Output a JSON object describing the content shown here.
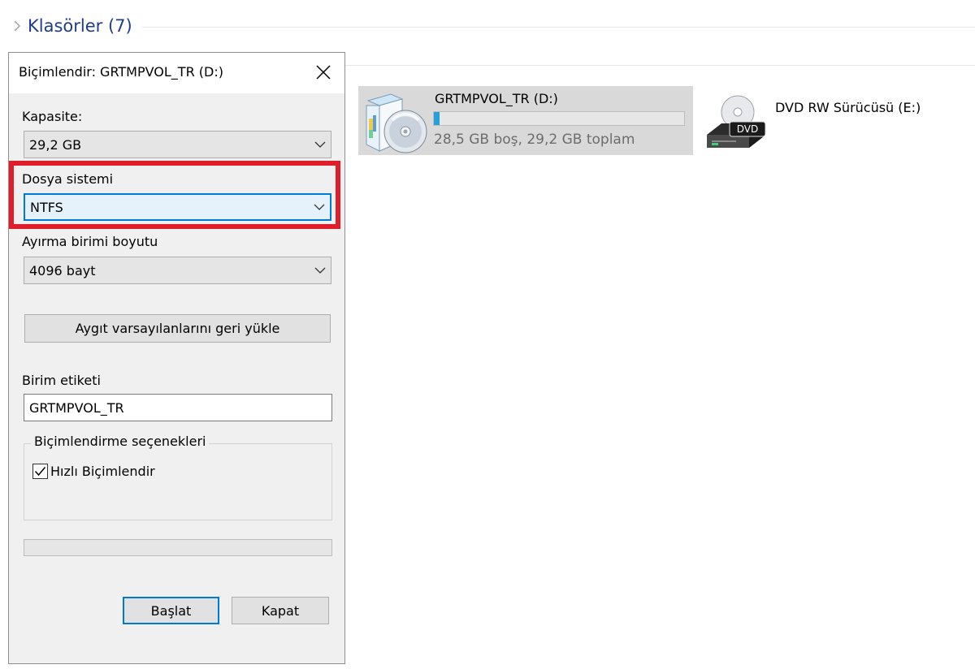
{
  "explorer": {
    "section_title": "Klasörler (7)",
    "drives": [
      {
        "name": "GRTMPVOL_TR (D:)",
        "space": "28,5 GB boş, 29,2 GB toplam",
        "used_fraction": 0.024,
        "bar_color": "#26a0da"
      },
      {
        "name": "DVD RW Sürücüsü (E:)",
        "icon_label": "DVD"
      }
    ]
  },
  "dialog": {
    "title": "Biçimlendir: GRTMPVOL_TR (D:)",
    "capacity_label": "Kapasite:",
    "capacity_value": "29,2 GB",
    "filesystem_label": "Dosya sistemi",
    "filesystem_value": "NTFS",
    "allocation_label": "Ayırma birimi boyutu",
    "allocation_value": "4096 bayt",
    "restore_button": "Aygıt varsayılanlarını geri yükle",
    "volume_label_label": "Birim etiketi",
    "volume_label_value": "GRTMPVOL_TR",
    "options_legend": "Biçimlendirme seçenekleri",
    "quick_format_label": "Hızlı Biçimlendir",
    "quick_format_checked": true,
    "progress_value": 0,
    "start_button": "Başlat",
    "close_button": "Kapat"
  },
  "colors": {
    "accent": "#0078d7",
    "highlight": "#e01e2b",
    "section_title": "#1e3d8c"
  }
}
